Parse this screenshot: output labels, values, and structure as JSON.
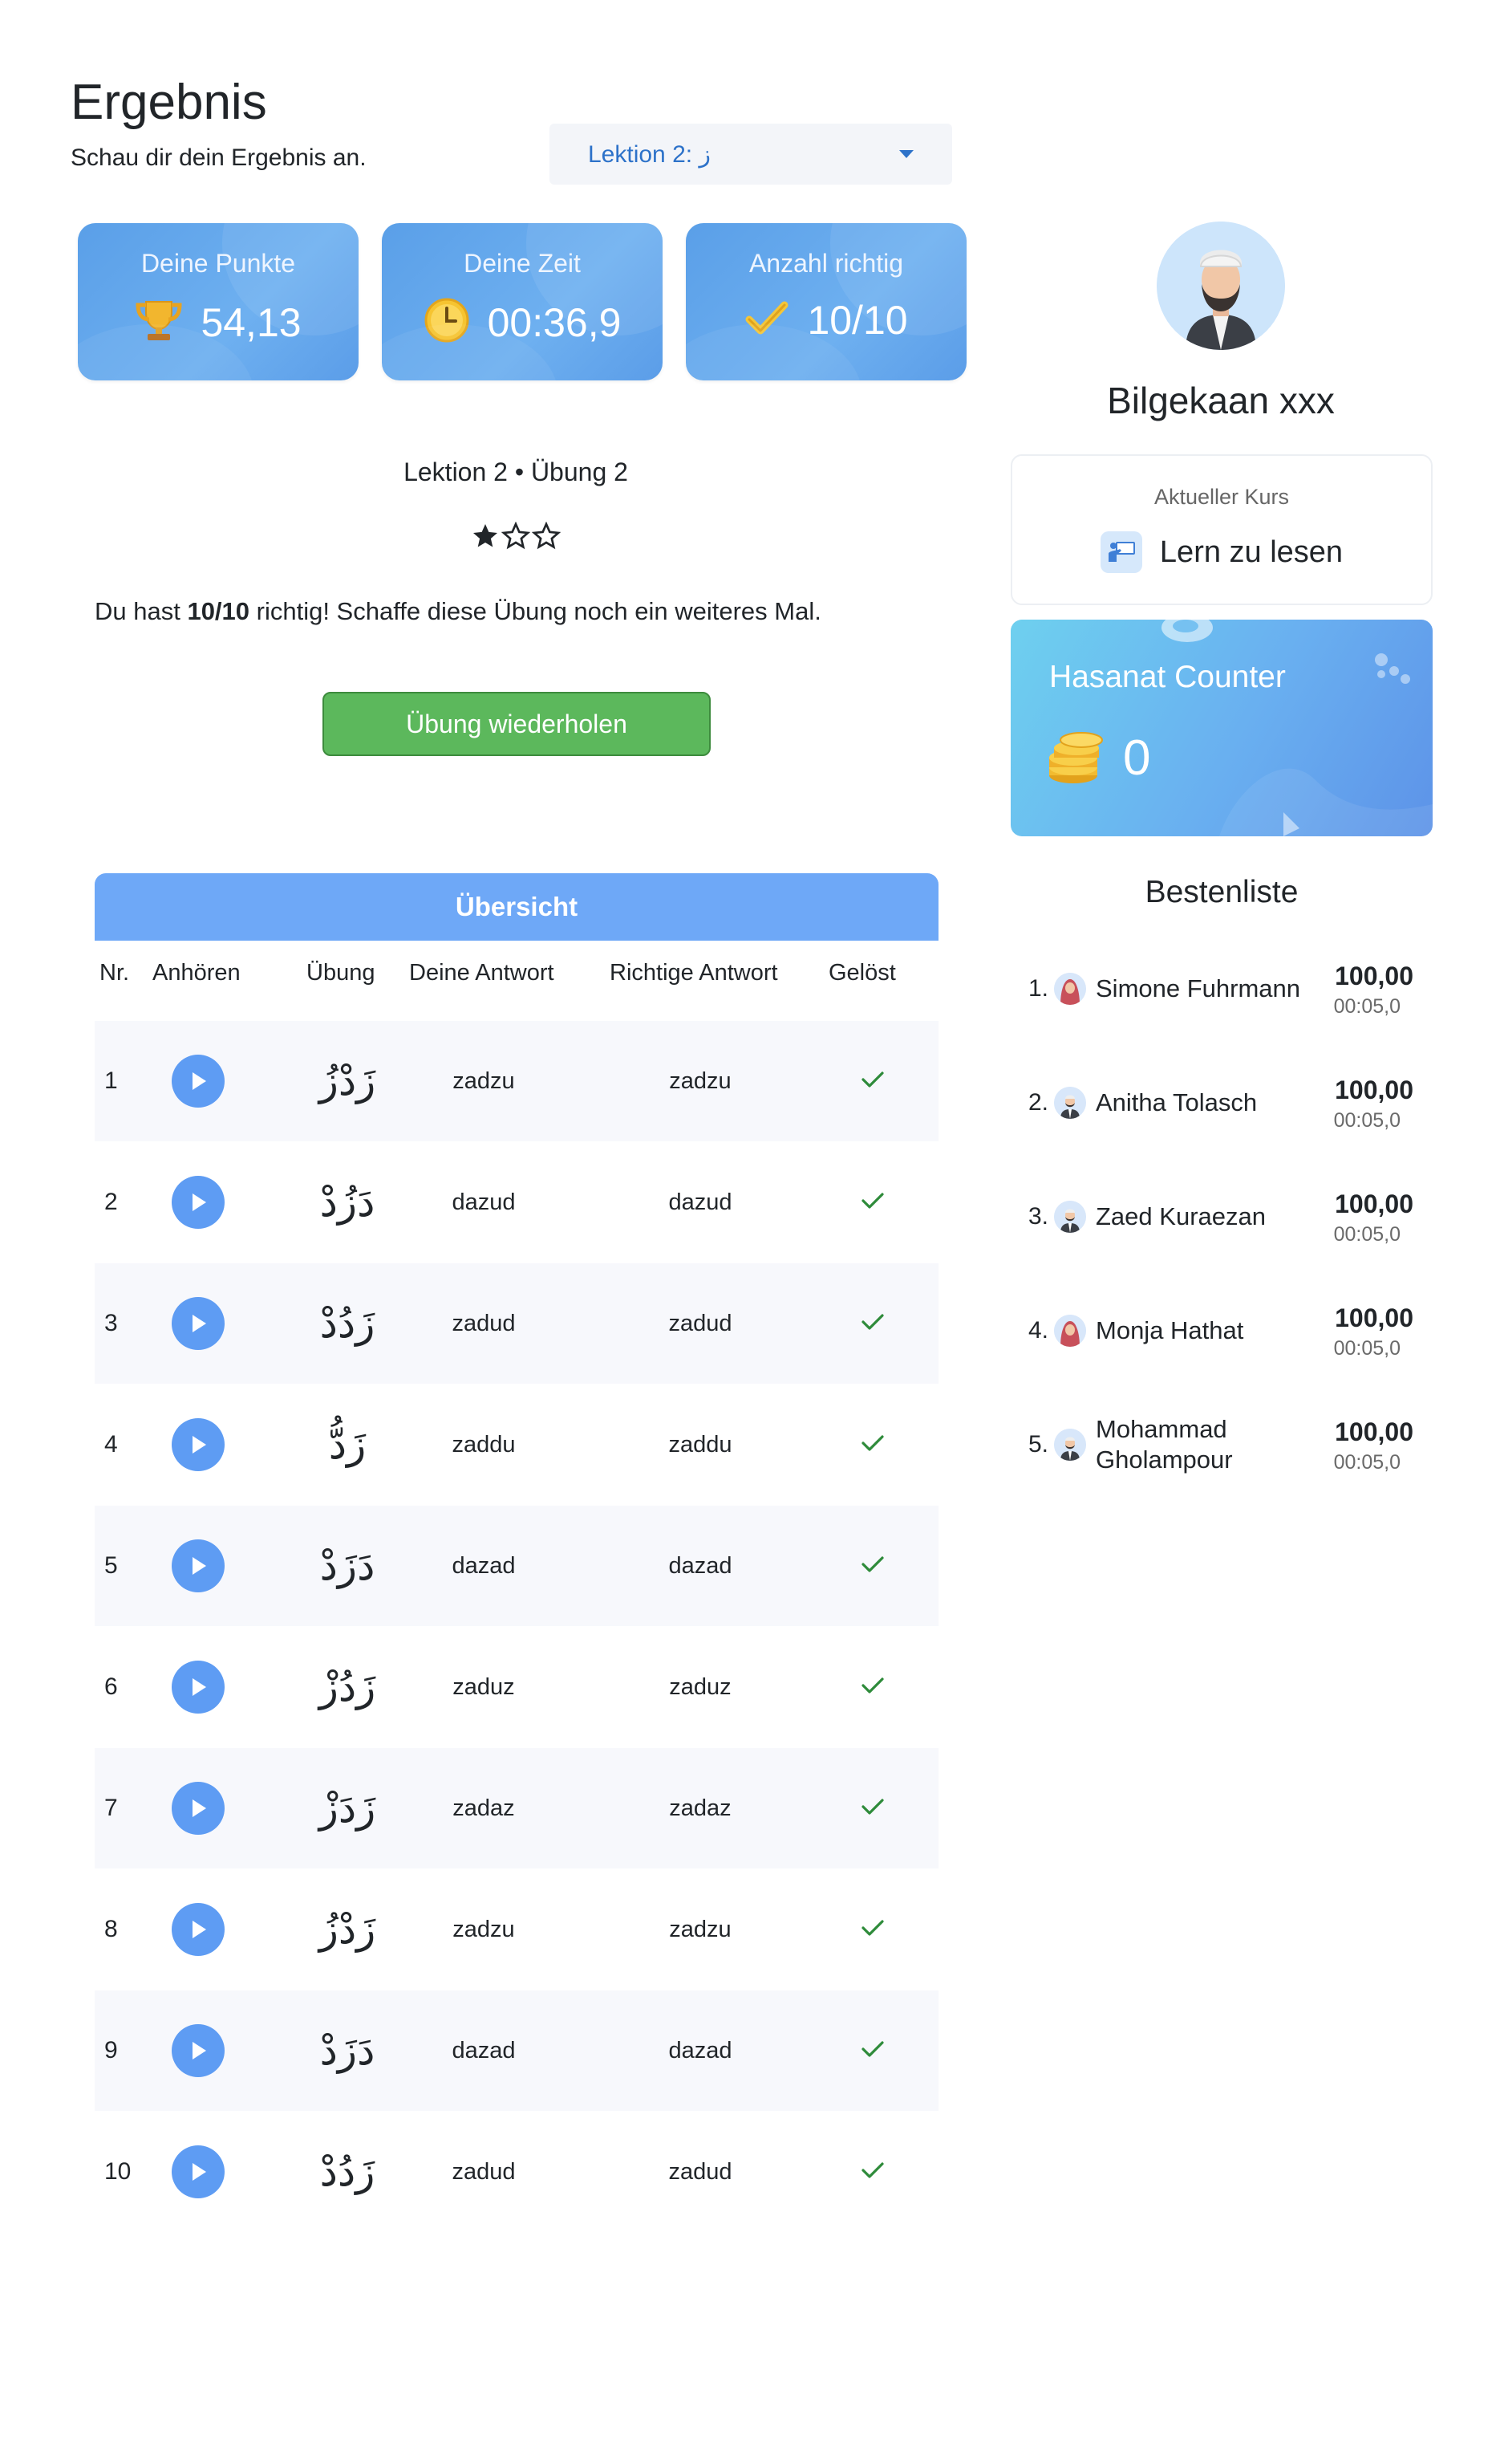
{
  "header": {
    "title": "Ergebnis",
    "subtitle": "Schau dir dein Ergebnis an.",
    "lesson_select": "Lektion 2: ز"
  },
  "stats": [
    {
      "label": "Deine Punkte",
      "value": "54,13",
      "icon": "trophy-icon"
    },
    {
      "label": "Deine Zeit",
      "value": "00:36,9",
      "icon": "clock-icon"
    },
    {
      "label": "Anzahl richtig",
      "value": "10/10",
      "icon": "checkmark-icon"
    }
  ],
  "lesson": {
    "heading": "Lektion 2 • Übung 2",
    "stars_filled": 1,
    "stars_total": 3,
    "message_prefix": "Du hast ",
    "message_score": "10/10",
    "message_suffix": " richtig! Schaffe diese Übung noch ein weiteres Mal.",
    "retry_label": "Übung wiederholen"
  },
  "overview": {
    "title": "Übersicht",
    "columns": [
      "Nr.",
      "Anhören",
      "Übung",
      "Deine Antwort",
      "Richtige Antwort",
      "Gelöst"
    ],
    "rows": [
      {
        "nr": "1",
        "arabic": "زَدْزُ",
        "answer": "zadzu",
        "correct": "zadzu",
        "solved": true
      },
      {
        "nr": "2",
        "arabic": "دَزُدْ",
        "answer": "dazud",
        "correct": "dazud",
        "solved": true
      },
      {
        "nr": "3",
        "arabic": "زَدُدْ",
        "answer": "zadud",
        "correct": "zadud",
        "solved": true
      },
      {
        "nr": "4",
        "arabic": "زَدُّ",
        "answer": "zaddu",
        "correct": "zaddu",
        "solved": true
      },
      {
        "nr": "5",
        "arabic": "دَزَدْ",
        "answer": "dazad",
        "correct": "dazad",
        "solved": true
      },
      {
        "nr": "6",
        "arabic": "زَدُزْ",
        "answer": "zaduz",
        "correct": "zaduz",
        "solved": true
      },
      {
        "nr": "7",
        "arabic": "زَدَزْ",
        "answer": "zadaz",
        "correct": "zadaz",
        "solved": true
      },
      {
        "nr": "8",
        "arabic": "زَدْزُ",
        "answer": "zadzu",
        "correct": "zadzu",
        "solved": true
      },
      {
        "nr": "9",
        "arabic": "دَزَدْ",
        "answer": "dazad",
        "correct": "dazad",
        "solved": true
      },
      {
        "nr": "10",
        "arabic": "زَدُدْ",
        "answer": "zadud",
        "correct": "zadud",
        "solved": true
      }
    ]
  },
  "profile": {
    "name": "Bilgekaan xxx",
    "course_label": "Aktueller Kurs",
    "course_name": "Lern zu lesen"
  },
  "hasanat": {
    "title": "Hasanat Counter",
    "value": "0"
  },
  "leaderboard": {
    "title": "Bestenliste",
    "entries": [
      {
        "rank": "1.",
        "name": "Simone Fuhrmann",
        "score": "100,00",
        "time": "00:05,0",
        "avatar": "female"
      },
      {
        "rank": "2.",
        "name": "Anitha Tolasch",
        "score": "100,00",
        "time": "00:05,0",
        "avatar": "male"
      },
      {
        "rank": "3.",
        "name": "Zaed Kuraezan",
        "score": "100,00",
        "time": "00:05,0",
        "avatar": "male"
      },
      {
        "rank": "4.",
        "name": "Monja Hathat",
        "score": "100,00",
        "time": "00:05,0",
        "avatar": "female"
      },
      {
        "rank": "5.",
        "name": "Mohammad Gholampour",
        "score": "100,00",
        "time": "00:05,0",
        "avatar": "male"
      }
    ]
  },
  "colors": {
    "accent": "#6ea8f7",
    "success": "#5cb85c",
    "check": "#2e8b3a",
    "link": "#2d72c9"
  }
}
